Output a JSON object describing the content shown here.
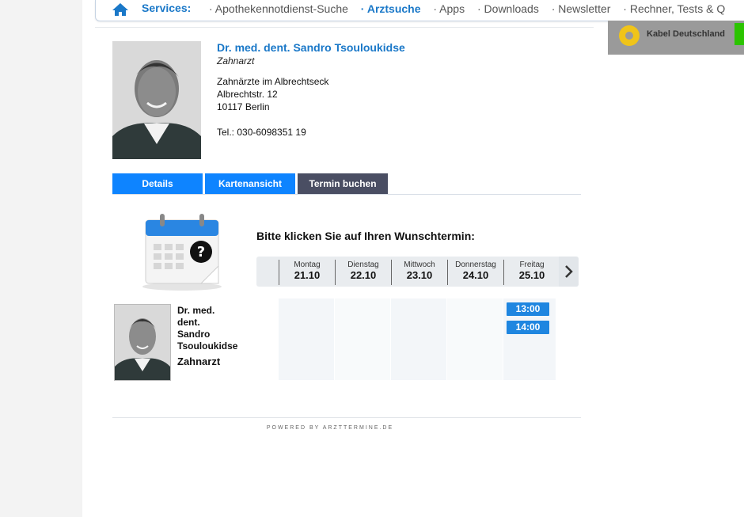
{
  "services_bar": {
    "label": "Services:",
    "items": [
      {
        "text": "· Apothekennotdienst-Suche"
      },
      {
        "text": "· Arztsuche"
      },
      {
        "text": "· Apps"
      },
      {
        "text": "· Downloads"
      },
      {
        "text": "· Newsletter"
      },
      {
        "text": "· Rechner, Tests & Q"
      }
    ],
    "active_item": "Arztsuche"
  },
  "ad": {
    "text": "Kabel Deutschland"
  },
  "doctor": {
    "name": "Dr. med. dent. Sandro Tsouloukidse",
    "specialty": "Zahnarzt",
    "practice": "Zahnärzte im Albrechtseck",
    "street": "Albrechtstr. 12",
    "city": "10117 Berlin",
    "phone": "Tel.: 030-6098351 19"
  },
  "tabs": [
    {
      "label": "Details",
      "color": "#0e84ff"
    },
    {
      "label": "Kartenansicht",
      "color": "#0e84ff"
    },
    {
      "label": "Termin buchen",
      "color": "#4a4e63"
    }
  ],
  "booking": {
    "prompt": "Bitte klicken Sie auf Ihren Wunschtermin:",
    "days": [
      {
        "name": "Montag",
        "date": "21.10"
      },
      {
        "name": "Dienstag",
        "date": "22.10"
      },
      {
        "name": "Mittwoch",
        "date": "23.10"
      },
      {
        "name": "Donnerstag",
        "date": "24.10"
      },
      {
        "name": "Freitag",
        "date": "25.10"
      }
    ],
    "doctor_name_lines": [
      "Dr. med.",
      "dent.",
      "Sandro",
      "Tsouloukidse"
    ],
    "doctor_specialty": "Zahnarzt",
    "slots": [
      "13:00",
      "14:00"
    ]
  },
  "footer": {
    "powered_by": "POWERED BY ARZTTERMINE.DE"
  },
  "colors": {
    "brand_blue": "#1a78c8",
    "tab_blue": "#0e84ff",
    "tab_active": "#4a4e63",
    "slot_blue": "#1f86e0"
  }
}
